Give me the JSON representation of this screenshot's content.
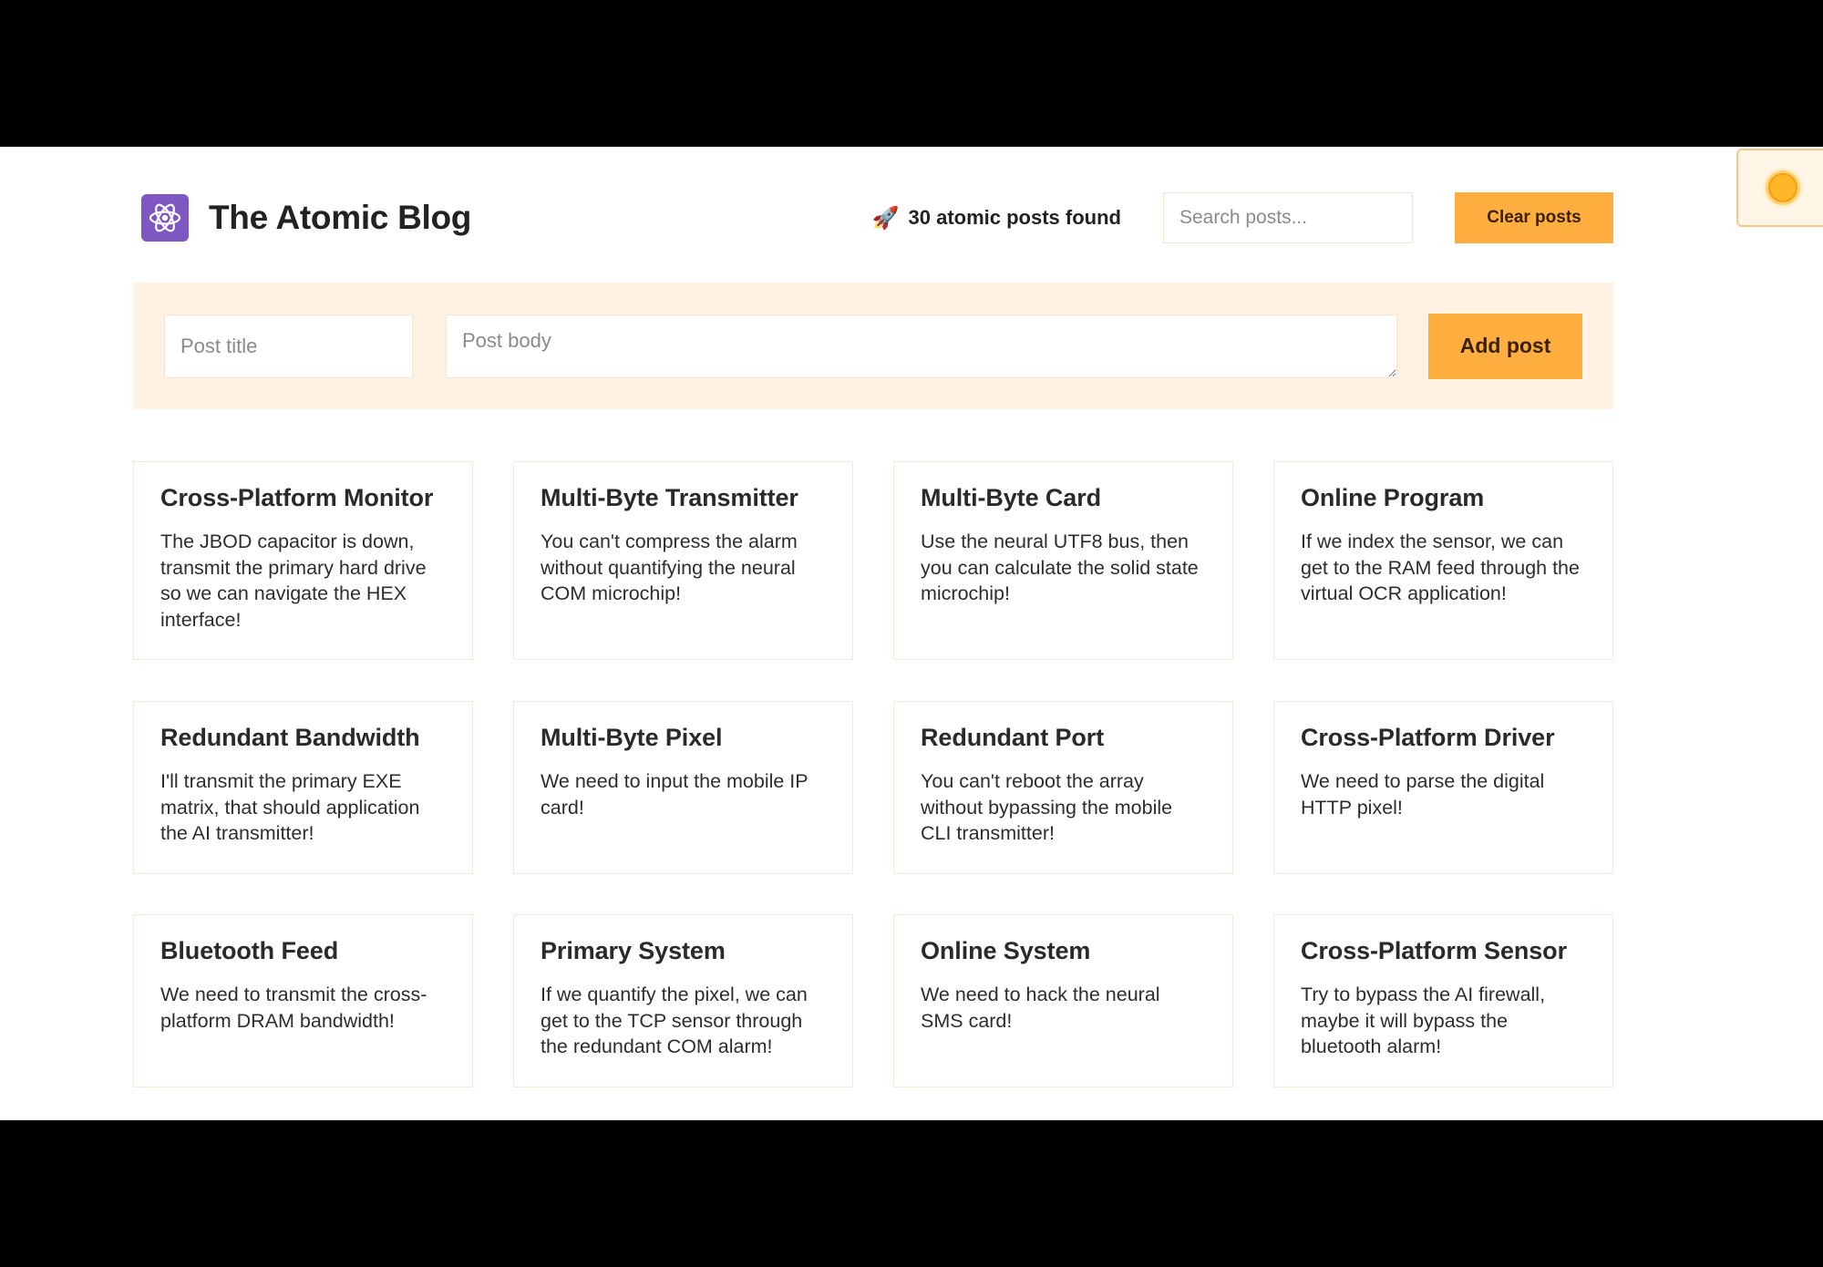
{
  "header": {
    "title": "The Atomic Blog",
    "posts_found": "30 atomic posts found",
    "rocket_icon": "rocket-icon",
    "search_placeholder": "Search posts...",
    "search_value": "",
    "clear_label": "Clear posts"
  },
  "form": {
    "title_placeholder": "Post title",
    "body_placeholder": "Post body",
    "title_value": "",
    "body_value": "",
    "add_label": "Add post"
  },
  "theme_toggle": {
    "icon": "sun-icon"
  },
  "colors": {
    "accent": "#ffae3f",
    "panel": "#fff2e3",
    "logo": "#7e57c2"
  },
  "posts": [
    {
      "title": "Cross-Platform Monitor",
      "body": "The JBOD capacitor is down, transmit the primary hard drive so we can navigate the HEX interface!"
    },
    {
      "title": "Multi-Byte Transmitter",
      "body": "You can't compress the alarm without quantifying the neural COM microchip!"
    },
    {
      "title": "Multi-Byte Card",
      "body": "Use the neural UTF8 bus, then you can calculate the solid state microchip!"
    },
    {
      "title": "Online Program",
      "body": "If we index the sensor, we can get to the RAM feed through the virtual OCR application!"
    },
    {
      "title": "Redundant Bandwidth",
      "body": "I'll transmit the primary EXE matrix, that should application the AI transmitter!"
    },
    {
      "title": "Multi-Byte Pixel",
      "body": "We need to input the mobile IP card!"
    },
    {
      "title": "Redundant Port",
      "body": "You can't reboot the array without bypassing the mobile CLI transmitter!"
    },
    {
      "title": "Cross-Platform Driver",
      "body": "We need to parse the digital HTTP pixel!"
    },
    {
      "title": "Bluetooth Feed",
      "body": "We need to transmit the cross-platform DRAM bandwidth!"
    },
    {
      "title": "Primary System",
      "body": "If we quantify the pixel, we can get to the TCP sensor through the redundant COM alarm!"
    },
    {
      "title": "Online System",
      "body": "We need to hack the neural SMS card!"
    },
    {
      "title": "Cross-Platform Sensor",
      "body": "Try to bypass the AI firewall, maybe it will bypass the bluetooth alarm!"
    }
  ]
}
